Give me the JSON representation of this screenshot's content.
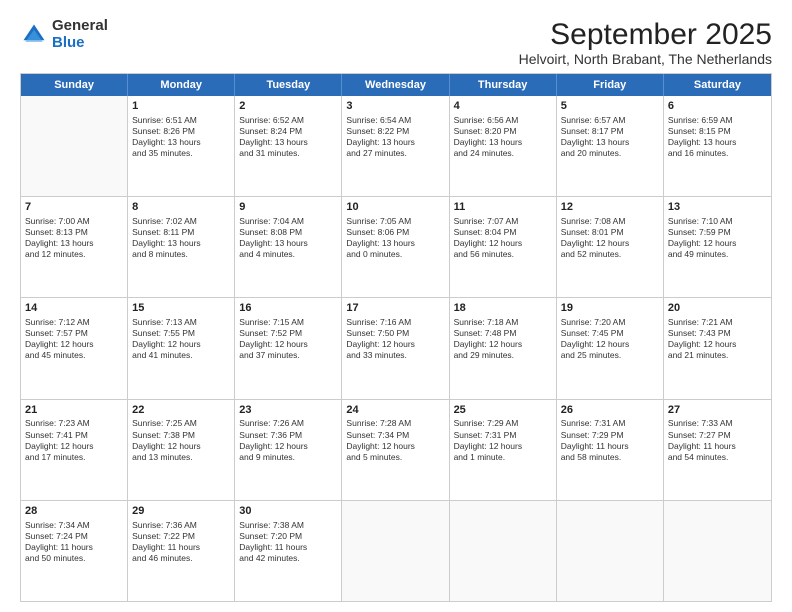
{
  "logo": {
    "general": "General",
    "blue": "Blue"
  },
  "title": "September 2025",
  "subtitle": "Helvoirt, North Brabant, The Netherlands",
  "header_days": [
    "Sunday",
    "Monday",
    "Tuesday",
    "Wednesday",
    "Thursday",
    "Friday",
    "Saturday"
  ],
  "rows": [
    [
      {
        "day": "",
        "lines": []
      },
      {
        "day": "1",
        "lines": [
          "Sunrise: 6:51 AM",
          "Sunset: 8:26 PM",
          "Daylight: 13 hours",
          "and 35 minutes."
        ]
      },
      {
        "day": "2",
        "lines": [
          "Sunrise: 6:52 AM",
          "Sunset: 8:24 PM",
          "Daylight: 13 hours",
          "and 31 minutes."
        ]
      },
      {
        "day": "3",
        "lines": [
          "Sunrise: 6:54 AM",
          "Sunset: 8:22 PM",
          "Daylight: 13 hours",
          "and 27 minutes."
        ]
      },
      {
        "day": "4",
        "lines": [
          "Sunrise: 6:56 AM",
          "Sunset: 8:20 PM",
          "Daylight: 13 hours",
          "and 24 minutes."
        ]
      },
      {
        "day": "5",
        "lines": [
          "Sunrise: 6:57 AM",
          "Sunset: 8:17 PM",
          "Daylight: 13 hours",
          "and 20 minutes."
        ]
      },
      {
        "day": "6",
        "lines": [
          "Sunrise: 6:59 AM",
          "Sunset: 8:15 PM",
          "Daylight: 13 hours",
          "and 16 minutes."
        ]
      }
    ],
    [
      {
        "day": "7",
        "lines": [
          "Sunrise: 7:00 AM",
          "Sunset: 8:13 PM",
          "Daylight: 13 hours",
          "and 12 minutes."
        ]
      },
      {
        "day": "8",
        "lines": [
          "Sunrise: 7:02 AM",
          "Sunset: 8:11 PM",
          "Daylight: 13 hours",
          "and 8 minutes."
        ]
      },
      {
        "day": "9",
        "lines": [
          "Sunrise: 7:04 AM",
          "Sunset: 8:08 PM",
          "Daylight: 13 hours",
          "and 4 minutes."
        ]
      },
      {
        "day": "10",
        "lines": [
          "Sunrise: 7:05 AM",
          "Sunset: 8:06 PM",
          "Daylight: 13 hours",
          "and 0 minutes."
        ]
      },
      {
        "day": "11",
        "lines": [
          "Sunrise: 7:07 AM",
          "Sunset: 8:04 PM",
          "Daylight: 12 hours",
          "and 56 minutes."
        ]
      },
      {
        "day": "12",
        "lines": [
          "Sunrise: 7:08 AM",
          "Sunset: 8:01 PM",
          "Daylight: 12 hours",
          "and 52 minutes."
        ]
      },
      {
        "day": "13",
        "lines": [
          "Sunrise: 7:10 AM",
          "Sunset: 7:59 PM",
          "Daylight: 12 hours",
          "and 49 minutes."
        ]
      }
    ],
    [
      {
        "day": "14",
        "lines": [
          "Sunrise: 7:12 AM",
          "Sunset: 7:57 PM",
          "Daylight: 12 hours",
          "and 45 minutes."
        ]
      },
      {
        "day": "15",
        "lines": [
          "Sunrise: 7:13 AM",
          "Sunset: 7:55 PM",
          "Daylight: 12 hours",
          "and 41 minutes."
        ]
      },
      {
        "day": "16",
        "lines": [
          "Sunrise: 7:15 AM",
          "Sunset: 7:52 PM",
          "Daylight: 12 hours",
          "and 37 minutes."
        ]
      },
      {
        "day": "17",
        "lines": [
          "Sunrise: 7:16 AM",
          "Sunset: 7:50 PM",
          "Daylight: 12 hours",
          "and 33 minutes."
        ]
      },
      {
        "day": "18",
        "lines": [
          "Sunrise: 7:18 AM",
          "Sunset: 7:48 PM",
          "Daylight: 12 hours",
          "and 29 minutes."
        ]
      },
      {
        "day": "19",
        "lines": [
          "Sunrise: 7:20 AM",
          "Sunset: 7:45 PM",
          "Daylight: 12 hours",
          "and 25 minutes."
        ]
      },
      {
        "day": "20",
        "lines": [
          "Sunrise: 7:21 AM",
          "Sunset: 7:43 PM",
          "Daylight: 12 hours",
          "and 21 minutes."
        ]
      }
    ],
    [
      {
        "day": "21",
        "lines": [
          "Sunrise: 7:23 AM",
          "Sunset: 7:41 PM",
          "Daylight: 12 hours",
          "and 17 minutes."
        ]
      },
      {
        "day": "22",
        "lines": [
          "Sunrise: 7:25 AM",
          "Sunset: 7:38 PM",
          "Daylight: 12 hours",
          "and 13 minutes."
        ]
      },
      {
        "day": "23",
        "lines": [
          "Sunrise: 7:26 AM",
          "Sunset: 7:36 PM",
          "Daylight: 12 hours",
          "and 9 minutes."
        ]
      },
      {
        "day": "24",
        "lines": [
          "Sunrise: 7:28 AM",
          "Sunset: 7:34 PM",
          "Daylight: 12 hours",
          "and 5 minutes."
        ]
      },
      {
        "day": "25",
        "lines": [
          "Sunrise: 7:29 AM",
          "Sunset: 7:31 PM",
          "Daylight: 12 hours",
          "and 1 minute."
        ]
      },
      {
        "day": "26",
        "lines": [
          "Sunrise: 7:31 AM",
          "Sunset: 7:29 PM",
          "Daylight: 11 hours",
          "and 58 minutes."
        ]
      },
      {
        "day": "27",
        "lines": [
          "Sunrise: 7:33 AM",
          "Sunset: 7:27 PM",
          "Daylight: 11 hours",
          "and 54 minutes."
        ]
      }
    ],
    [
      {
        "day": "28",
        "lines": [
          "Sunrise: 7:34 AM",
          "Sunset: 7:24 PM",
          "Daylight: 11 hours",
          "and 50 minutes."
        ]
      },
      {
        "day": "29",
        "lines": [
          "Sunrise: 7:36 AM",
          "Sunset: 7:22 PM",
          "Daylight: 11 hours",
          "and 46 minutes."
        ]
      },
      {
        "day": "30",
        "lines": [
          "Sunrise: 7:38 AM",
          "Sunset: 7:20 PM",
          "Daylight: 11 hours",
          "and 42 minutes."
        ]
      },
      {
        "day": "",
        "lines": []
      },
      {
        "day": "",
        "lines": []
      },
      {
        "day": "",
        "lines": []
      },
      {
        "day": "",
        "lines": []
      }
    ]
  ]
}
